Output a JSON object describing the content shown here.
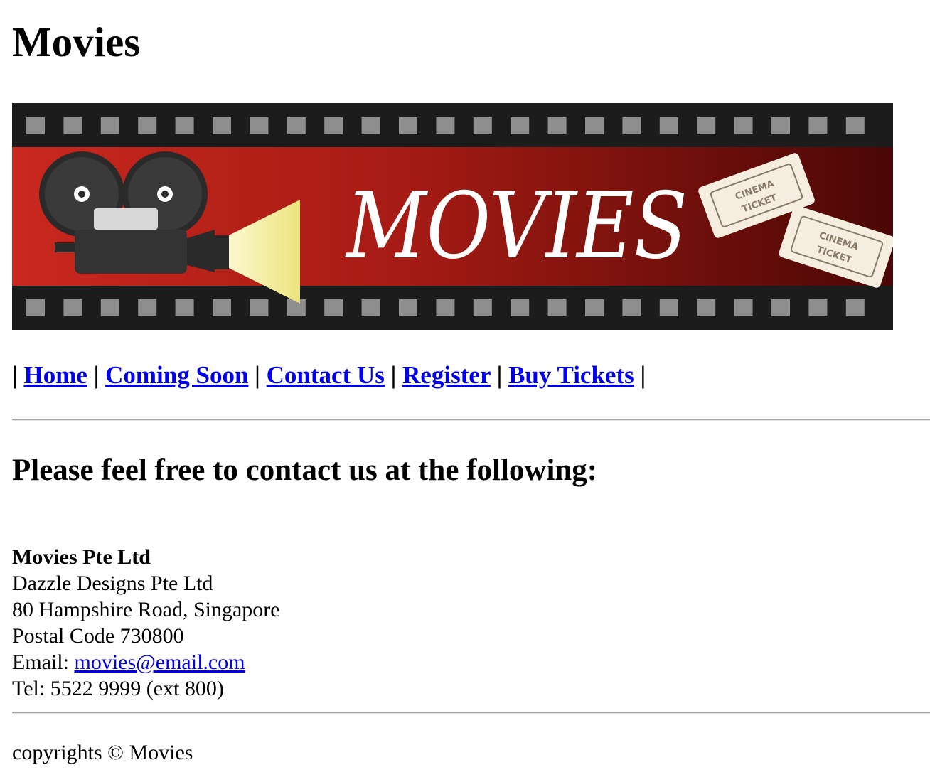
{
  "page": {
    "title": "Movies"
  },
  "banner": {
    "text": "MOVIES",
    "ticket_text_1": "CINEMA",
    "ticket_text_2": "TICKET",
    "colors": {
      "film_strip": "#1c1c1c",
      "sprocket": "#8e8e8e",
      "red_left": "#c9281e",
      "red_right": "#4a0705",
      "text": "#ffffff",
      "light_beam": "#f3ee9a"
    }
  },
  "nav": {
    "separator": "|",
    "items": [
      {
        "label": "Home"
      },
      {
        "label": "Coming Soon"
      },
      {
        "label": "Contact Us"
      },
      {
        "label": "Register"
      },
      {
        "label": "Buy Tickets"
      }
    ]
  },
  "main": {
    "heading": "Please feel free to contact us at the following:",
    "company": "Movies Pte Ltd",
    "address_line_1": "Dazzle Designs Pte Ltd",
    "address_line_2": "80 Hampshire Road, Singapore",
    "postal": "Postal Code 730800",
    "email_label": "Email: ",
    "email": "movies@email.com",
    "tel": "Tel: 5522 9999 (ext 800)"
  },
  "footer": {
    "copyright": "copyrights © Movies"
  },
  "colors": {
    "link": "#0000ee",
    "rule": "#a6a6a6"
  }
}
